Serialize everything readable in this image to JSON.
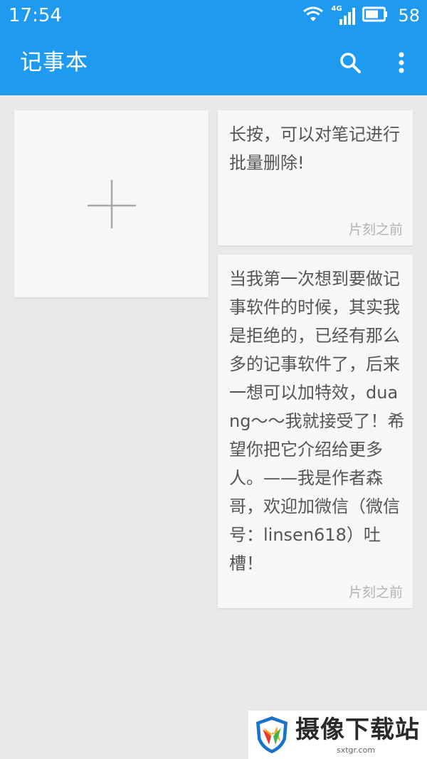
{
  "status_bar": {
    "time": "17:54",
    "network_label": "4G",
    "battery_level": "58"
  },
  "toolbar": {
    "title": "记事本",
    "search_icon": "search-icon",
    "more_icon": "more-vert-icon"
  },
  "add_card": {
    "icon": "plus-icon"
  },
  "notes": [
    {
      "text": "长按，可以对笔记进行批量删除!",
      "time": "片刻之前"
    },
    {
      "text": "当我第一次想到要做记事软件的时候，其实我是拒绝的，已经有那么多的记事软件了，后来一想可以加特效，duang～～我就接受了！希望你把它介绍给更多人。——我是作者森哥，欢迎加微信（微信号：linsen618）吐槽！",
      "time": "片刻之前"
    }
  ],
  "watermark": {
    "title": "摄像下载站",
    "url": "sxtgr.com"
  },
  "colors": {
    "primary": "#1e9bf0",
    "background": "#e9e9e9",
    "card": "#f7f7f7",
    "note_text": "#555555",
    "time_text": "#b3b3b3"
  }
}
